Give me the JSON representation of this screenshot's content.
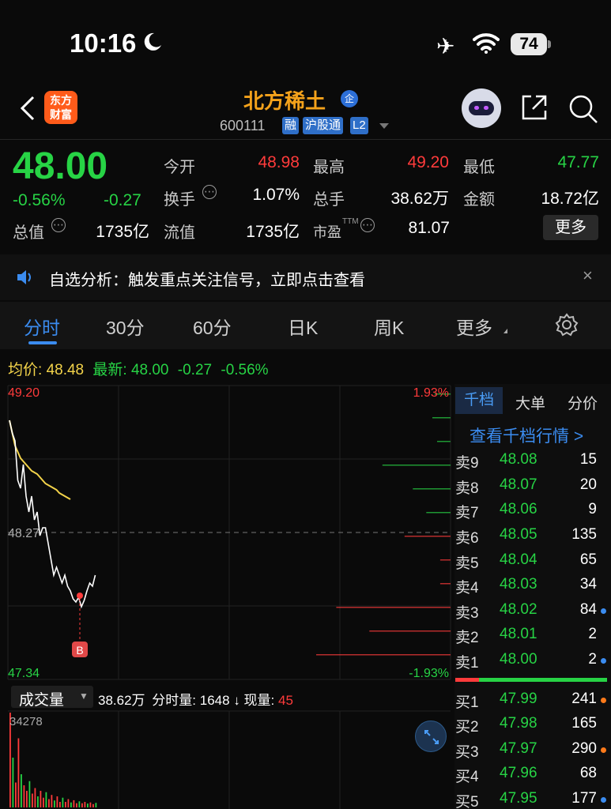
{
  "status_bar": {
    "time": "10:16",
    "battery": "74"
  },
  "header": {
    "stock_name": "北方稀土",
    "enterprise_badge": "企",
    "code": "600111",
    "tags": [
      "融",
      "沪股通",
      "L2"
    ],
    "logo_text": [
      "东方",
      "财富"
    ]
  },
  "quote": {
    "price": "48.00",
    "change_pct": "-0.56%",
    "change": "-0.27",
    "open_label": "今开",
    "open": "48.98",
    "high_label": "最高",
    "high": "49.20",
    "low_label": "最低",
    "low": "47.77",
    "turnover_label": "换手",
    "turnover": "1.07%",
    "volume_label": "总手",
    "volume": "38.62万",
    "amount_label": "金额",
    "amount": "18.72亿",
    "mktcap_label": "总值",
    "mktcap": "1735亿",
    "float_label": "流值",
    "float_cap": "1735亿",
    "pe_label": "市盈",
    "pe_sup": "TTM",
    "pe": "81.07",
    "more": "更多"
  },
  "banner": {
    "text": "自选分析：触发重点关注信号，立即点击查看"
  },
  "tabs": [
    "分时",
    "30分",
    "60分",
    "日K",
    "周K",
    "更多"
  ],
  "chart_info": {
    "avg_label": "均价:",
    "avg": "48.48",
    "latest_label": "最新:",
    "latest": "48.00",
    "latest_change": "-0.27",
    "latest_pct": "-0.56%"
  },
  "chart_data": {
    "type": "line",
    "y_labels": {
      "top": "49.20",
      "mid": "48.27",
      "bottom": "47.34",
      "top_pct": "1.93%",
      "bottom_pct": "-1.93%"
    },
    "ylim": [
      47.34,
      49.2
    ],
    "series": [
      {
        "values": [
          48.98,
          48.9,
          48.85,
          48.6,
          48.55,
          48.7,
          48.5,
          48.4,
          48.5,
          48.35,
          48.4,
          48.25,
          48.3,
          48.3,
          48.2,
          48.1,
          48.0,
          48.05,
          48.0,
          47.95,
          48.0,
          47.93,
          47.9,
          47.85,
          47.83,
          47.86,
          47.8,
          47.84,
          47.9,
          47.95,
          47.93,
          48.0
        ]
      },
      {
        "values": [
          48.98,
          48.9,
          48.82,
          48.78,
          48.74,
          48.72,
          48.7,
          48.68,
          48.66,
          48.65,
          48.64,
          48.62,
          48.6,
          48.58,
          48.57,
          48.56,
          48.55,
          48.54,
          48.52,
          48.51,
          48.5,
          48.49,
          48.48
        ]
      }
    ],
    "marker": "B",
    "volume": {
      "label": "成交量",
      "total": "38.62万",
      "min_vol_label": "分时量:",
      "min_vol": "1648",
      "now_label": "现量:",
      "now": "45",
      "max": "34278",
      "values": [
        34278,
        18000,
        9000,
        25000,
        12000,
        8000,
        6000,
        9500,
        5000,
        7000,
        4000,
        6000,
        3500,
        5500,
        3000,
        4500,
        2500,
        4000,
        2000,
        3500,
        2000,
        3000,
        1800,
        2600,
        1500,
        2200,
        1500,
        2000,
        1400,
        1800,
        1200,
        1648
      ]
    }
  },
  "order_book": {
    "tabs": [
      "千档",
      "大单",
      "分价"
    ],
    "link": "查看千档行情 >",
    "asks": [
      {
        "label": "卖9",
        "price": "48.08",
        "vol": "15"
      },
      {
        "label": "卖8",
        "price": "48.07",
        "vol": "20"
      },
      {
        "label": "卖7",
        "price": "48.06",
        "vol": "9"
      },
      {
        "label": "卖6",
        "price": "48.05",
        "vol": "135"
      },
      {
        "label": "卖5",
        "price": "48.04",
        "vol": "65"
      },
      {
        "label": "卖4",
        "price": "48.03",
        "vol": "34"
      },
      {
        "label": "卖3",
        "price": "48.02",
        "vol": "84"
      },
      {
        "label": "卖2",
        "price": "48.01",
        "vol": "2"
      },
      {
        "label": "卖1",
        "price": "48.00",
        "vol": "2"
      }
    ],
    "bids": [
      {
        "label": "买1",
        "price": "47.99",
        "vol": "241"
      },
      {
        "label": "买2",
        "price": "47.98",
        "vol": "165"
      },
      {
        "label": "买3",
        "price": "47.97",
        "vol": "290"
      },
      {
        "label": "买4",
        "price": "47.96",
        "vol": "68"
      },
      {
        "label": "买5",
        "price": "47.95",
        "vol": "177"
      }
    ]
  }
}
